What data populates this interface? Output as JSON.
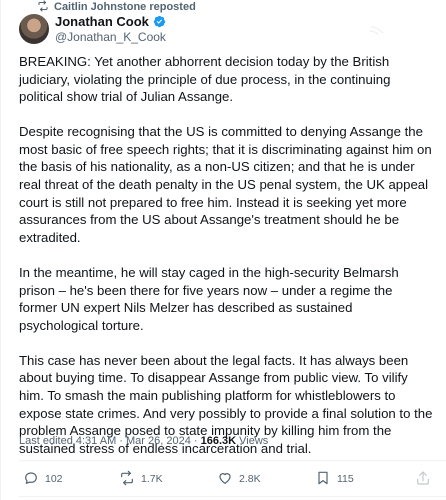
{
  "repost": {
    "label": "Caitlin Johnstone reposted",
    "icon": "repost-icon"
  },
  "author": {
    "name": "Jonathan Cook",
    "handle": "@Jonathan_K_Cook",
    "verified": true,
    "verified_color": "#1d9bf0"
  },
  "tweet": {
    "paragraphs": [
      "BREAKING: Yet another abhorrent decision today by the British judiciary, violating the principle of due process, in the continuing political show trial of Julian Assange.",
      "Despite recognising that the US is committed to denying Assange the most basic of free speech rights; that it is discriminating against him on the basis of his nationality, as a non-US citizen; and that he is under real threat of the death penalty in the US penal system, the UK appeal court is still not prepared to free him. Instead it is seeking yet more assurances from the US about Assange's treatment should he be extradited.",
      "In the meantime, he will stay caged in the high-security Belmarsh prison – he's been there for five years now – under a regime the former UN expert Nils Melzer has described as sustained psychological torture.",
      "This case has never been about the legal facts. It has always been about buying time. To disappear Assange from public view. To vilify him. To smash the main publishing platform for whistleblowers to expose state crimes. And very possibly to provide a final solution to the problem Assange posed to state impunity by killing him from the sustained stress of endless incarceration and trial."
    ]
  },
  "meta": {
    "last_edited": "Last edited 4:31 AM · Mar 26, 2024 · ",
    "views_count": "166.3K",
    "views_label": " Views"
  },
  "actions": {
    "replies": "102",
    "reposts": "1.7K",
    "likes": "2.8K",
    "bookmarks": "115"
  },
  "colors": {
    "text_primary": "#0f1419",
    "text_secondary": "#536471",
    "divider": "#eff3f4",
    "accent": "#1d9bf0"
  }
}
